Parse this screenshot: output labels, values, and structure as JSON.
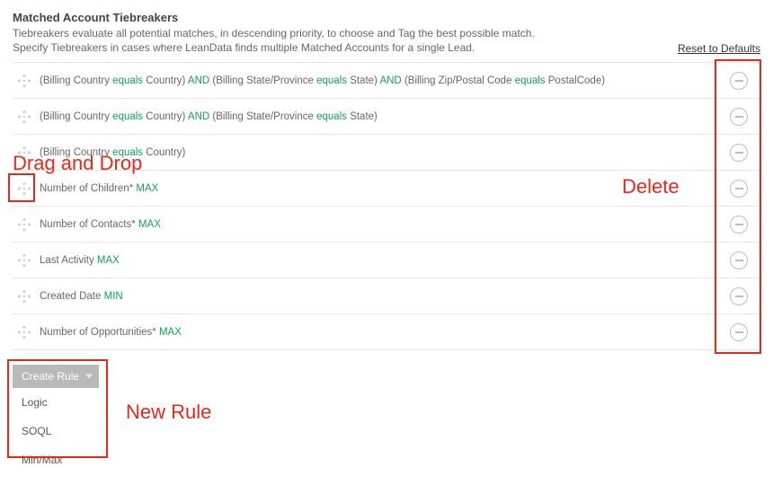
{
  "header": {
    "title": "Matched Account Tiebreakers",
    "subtitle_line1": "Tiebreakers evaluate all potential matches, in descending priority, to choose and Tag the best possible match.",
    "subtitle_line2": "Specify Tiebreakers in cases where LeanData finds multiple Matched Accounts for a single Lead.",
    "reset_label": "Reset to Defaults"
  },
  "operators": {
    "equals": "equals",
    "and": "AND",
    "max": "MAX",
    "min": "MIN"
  },
  "rules": [
    {
      "type": "logic",
      "clauses": [
        {
          "left": "Billing Country",
          "op": "equals",
          "right": "Country"
        },
        {
          "left": "Billing State/Province",
          "op": "equals",
          "right": "State"
        },
        {
          "left": "Billing Zip/Postal Code",
          "op": "equals",
          "right": "PostalCode"
        }
      ]
    },
    {
      "type": "logic",
      "clauses": [
        {
          "left": "Billing Country",
          "op": "equals",
          "right": "Country"
        },
        {
          "left": "Billing State/Province",
          "op": "equals",
          "right": "State"
        }
      ]
    },
    {
      "type": "logic",
      "clauses": [
        {
          "left": "Billing Country",
          "op": "equals",
          "right": "Country"
        }
      ]
    },
    {
      "type": "minmax",
      "field": "Number of Children*",
      "agg": "MAX"
    },
    {
      "type": "minmax",
      "field": "Number of Contacts*",
      "agg": "MAX"
    },
    {
      "type": "minmax",
      "field": "Last Activity",
      "agg": "MAX"
    },
    {
      "type": "minmax",
      "field": "Created Date",
      "agg": "MIN"
    },
    {
      "type": "minmax",
      "field": "Number of Opportunities*",
      "agg": "MAX"
    }
  ],
  "create": {
    "button_label": "Create Rule",
    "options": [
      "Logic",
      "SOQL",
      "Min/Max"
    ]
  },
  "annotations": {
    "drag_label": "Drag and Drop",
    "delete_label": "Delete",
    "new_rule_label": "New Rule"
  }
}
